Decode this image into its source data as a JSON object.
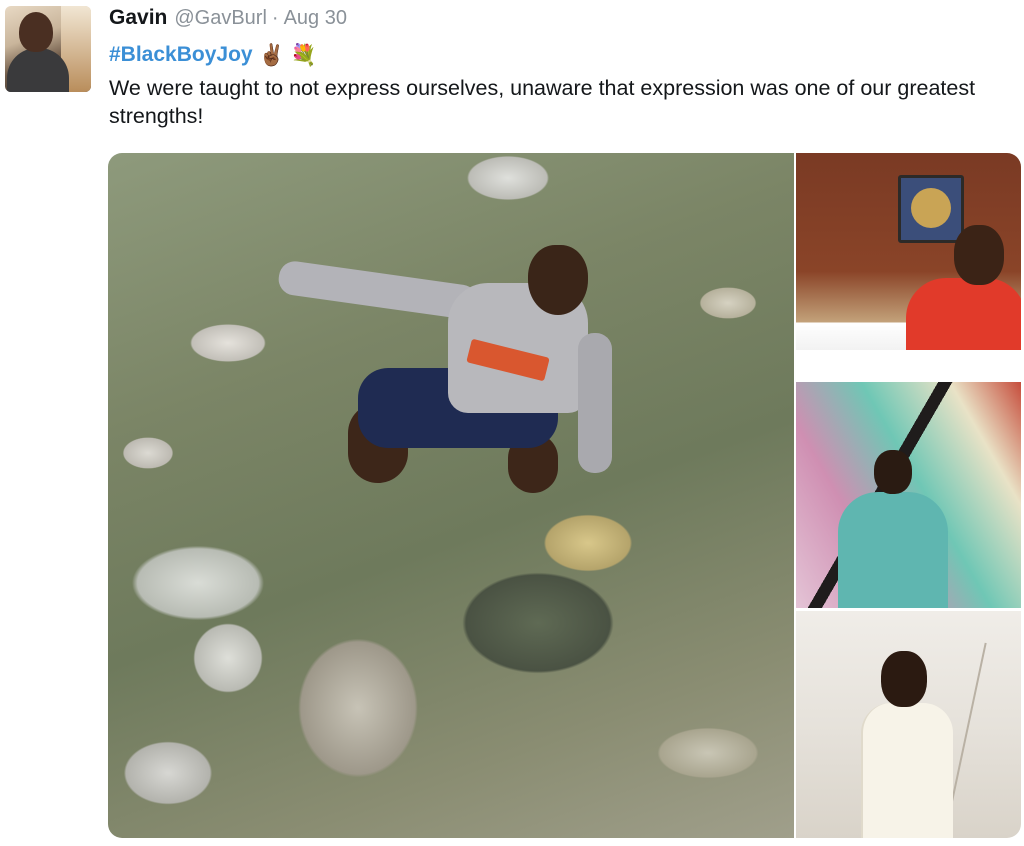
{
  "tweet": {
    "display_name": "Gavin",
    "handle": "@GavBurl",
    "separator": "·",
    "date": "Aug 30",
    "hashtag": "#BlackBoyJoy",
    "emoji_1": "✌🏾",
    "emoji_2": "💐",
    "text": "We were taught to not express ourselves, unaware that expression was one of our greatest strengths!"
  },
  "media": {
    "photo_count": 4
  },
  "colors": {
    "hashtag": "#3b8fd6",
    "muted": "#8a9198",
    "text": "#14171a"
  },
  "icons": [
    "avatar",
    "victory-hand-emoji",
    "bouquet-emoji"
  ]
}
